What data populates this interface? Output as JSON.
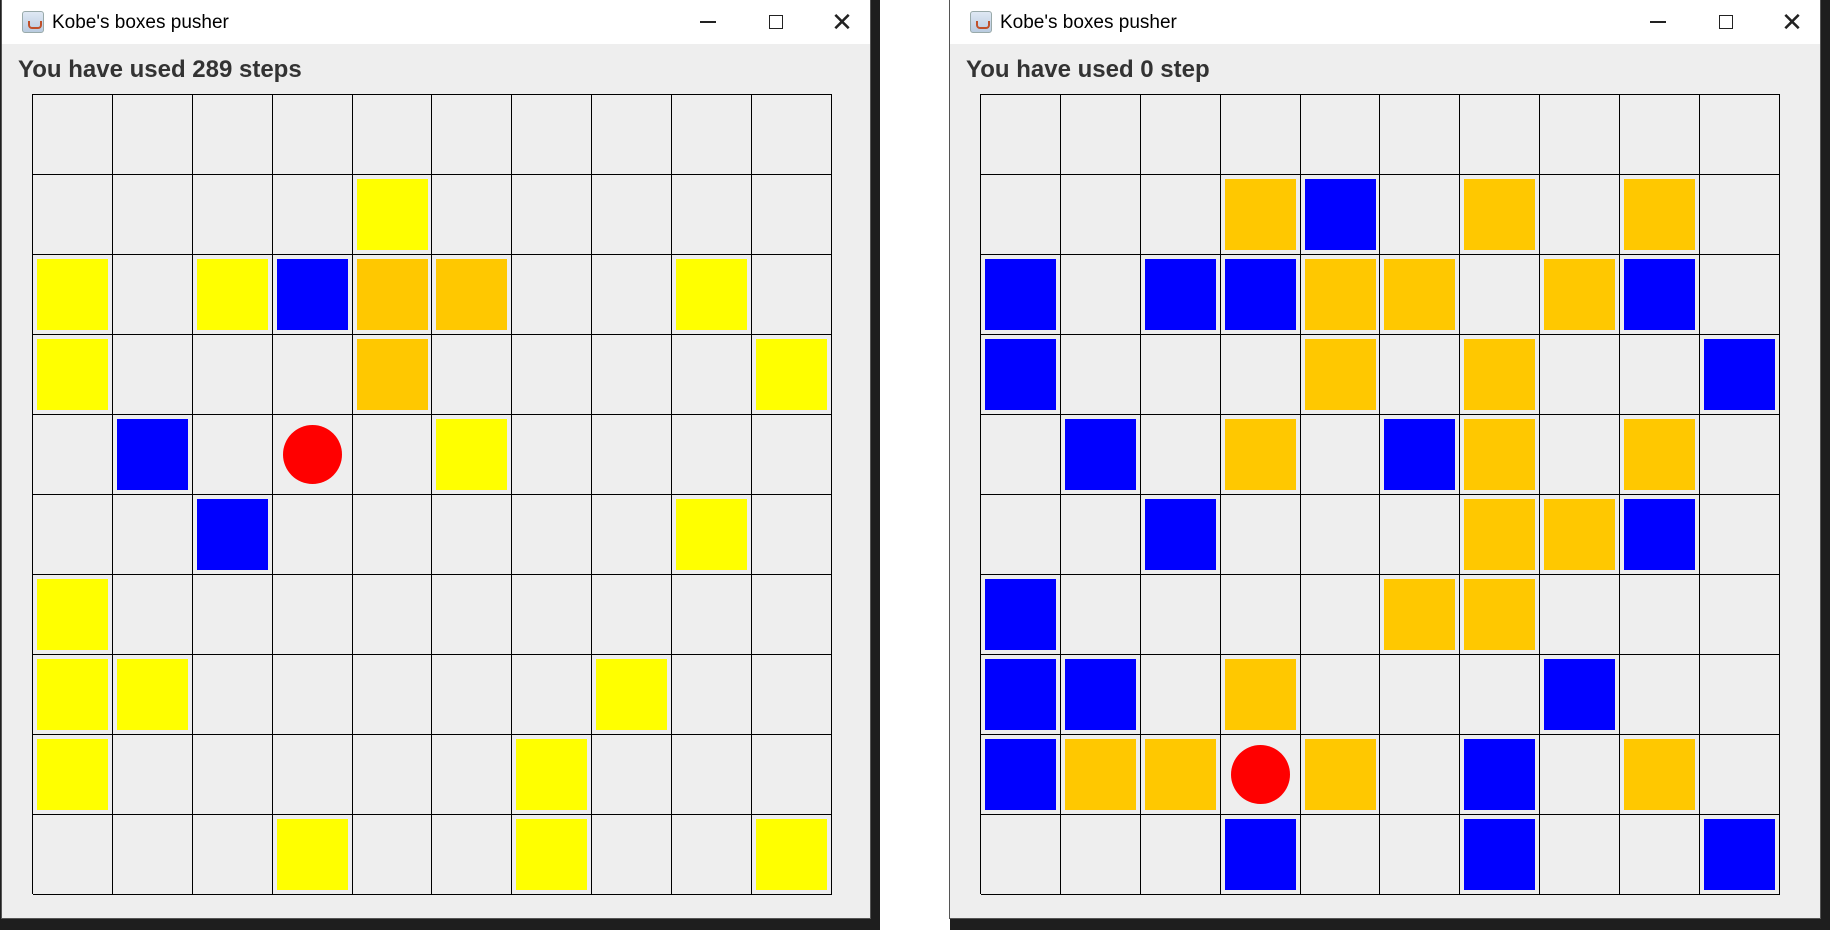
{
  "colors": {
    "wall": "#0000ff",
    "box_target": "#ffff00",
    "box": "#ffc800",
    "player": "#ff0000"
  },
  "windows": [
    {
      "title": "Kobe's boxes pusher",
      "steps_text": "You have used 289 steps",
      "grid": [
        "..........",
        "....T.....",
        "T.TWBB..T.",
        "T...B....T",
        ".W.P.T....",
        "..W.....T.",
        "T.........",
        "TT.....T..",
        "T.....T...",
        "...T..T..T"
      ]
    },
    {
      "title": "Kobe's boxes pusher",
      "steps_text": "You have used 0 step",
      "grid": [
        "..........",
        "...BW.B.B.",
        "W.WWBB.BW.",
        "W...B.B..W",
        ".W.B.WB.B.",
        "..W...BBW.",
        "W....BB...",
        "WW.B...W..",
        "WBBPB.W.B.",
        "...W..W..W"
      ]
    }
  ],
  "icons": {
    "app": "java-coffee-icon",
    "minimize": "minimize-icon",
    "maximize": "maximize-icon",
    "close": "close-icon"
  }
}
